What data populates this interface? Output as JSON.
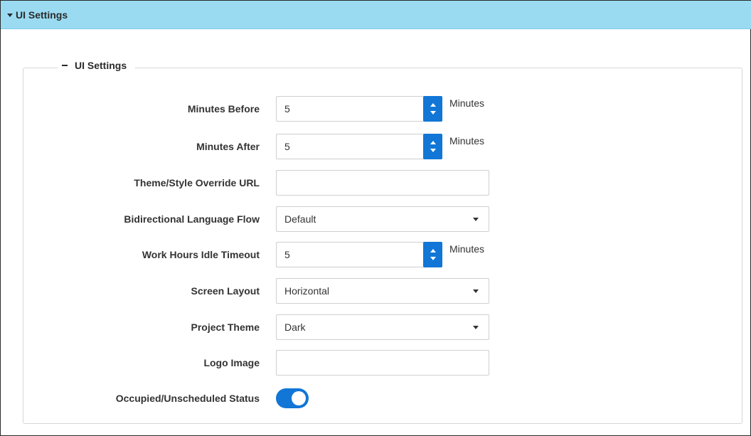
{
  "header": {
    "title": "UI Settings"
  },
  "section": {
    "title": "UI Settings"
  },
  "fields": {
    "minutes_before": {
      "label": "Minutes Before",
      "value": "5",
      "unit": "Minutes"
    },
    "minutes_after": {
      "label": "Minutes After",
      "value": "5",
      "unit": "Minutes"
    },
    "theme_url": {
      "label": "Theme/Style Override URL",
      "value": ""
    },
    "bidi": {
      "label": "Bidirectional Language Flow",
      "value": "Default"
    },
    "idle_timeout": {
      "label": "Work Hours Idle Timeout",
      "value": "5",
      "unit": "Minutes"
    },
    "screen_layout": {
      "label": "Screen Layout",
      "value": "Horizontal"
    },
    "project_theme": {
      "label": "Project Theme",
      "value": "Dark"
    },
    "logo_image": {
      "label": "Logo Image",
      "value": ""
    },
    "occupied_status": {
      "label": "Occupied/Unscheduled Status",
      "enabled": true
    }
  },
  "colors": {
    "header_bg": "#9adbf2",
    "accent": "#1176d6"
  }
}
